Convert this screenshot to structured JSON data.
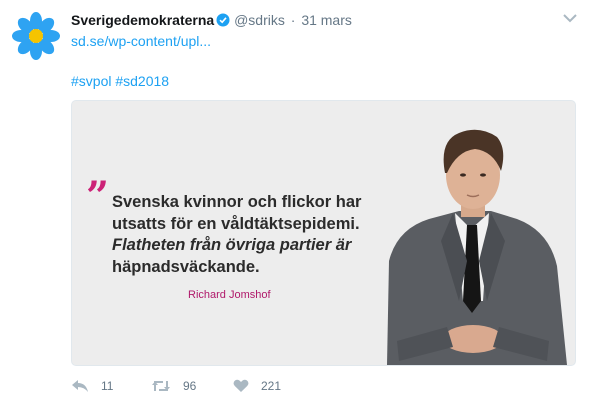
{
  "tweet": {
    "display_name": "Sverigedemokraterna",
    "handle": "@sdriks",
    "separator": "·",
    "timestamp": "31 mars",
    "link": "sd.se/wp-content/upl...",
    "hashtags": "#svpol #sd2018",
    "verified_icon": "verified-badge-icon",
    "menu_icon": "chevron-down-icon",
    "colors": {
      "link": "#1da1f2",
      "muted": "#657786",
      "quote_accent": "#cc2277",
      "author": "#b0186a"
    }
  },
  "media": {
    "quote_mark": "”",
    "quote_lines": [
      "Svenska kvinnor och flickor har",
      "utsatts för en våldtäktsepidemi.",
      "Flatheten från övriga partier är",
      "häpnadsväckande."
    ],
    "author": "Richard Jomshof"
  },
  "actions": {
    "reply_count": "11",
    "retweet_count": "96",
    "like_count": "221"
  }
}
